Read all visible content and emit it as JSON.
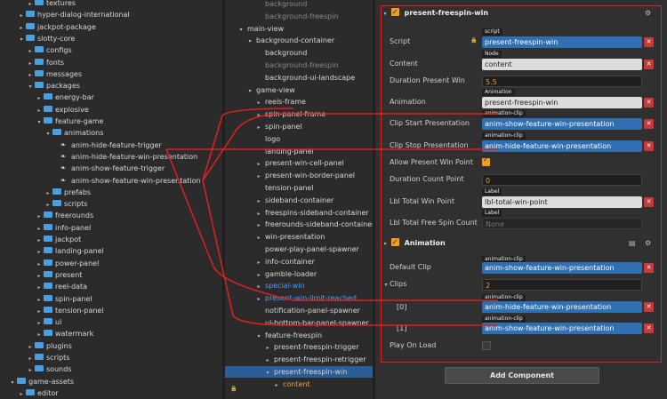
{
  "assets": {
    "items": [
      {
        "label": "textures",
        "depth": 3,
        "arrow": "▸",
        "kind": "folder"
      },
      {
        "label": "hyper-dialog-international",
        "depth": 2,
        "arrow": "▸",
        "kind": "folder"
      },
      {
        "label": "jackpot-package",
        "depth": 2,
        "arrow": "▸",
        "kind": "folder"
      },
      {
        "label": "slotty-core",
        "depth": 2,
        "arrow": "▾",
        "kind": "folder"
      },
      {
        "label": "configs",
        "depth": 3,
        "arrow": "▸",
        "kind": "folder"
      },
      {
        "label": "fonts",
        "depth": 3,
        "arrow": "▸",
        "kind": "folder"
      },
      {
        "label": "messages",
        "depth": 3,
        "arrow": "▸",
        "kind": "folder"
      },
      {
        "label": "packages",
        "depth": 3,
        "arrow": "▾",
        "kind": "folder"
      },
      {
        "label": "energy-bar",
        "depth": 4,
        "arrow": "▸",
        "kind": "folder"
      },
      {
        "label": "explosive",
        "depth": 4,
        "arrow": "▸",
        "kind": "folder"
      },
      {
        "label": "feature-game",
        "depth": 4,
        "arrow": "▾",
        "kind": "folder"
      },
      {
        "label": "animations",
        "depth": 5,
        "arrow": "▾",
        "kind": "folder"
      },
      {
        "label": "anim-hide-feature-trigger",
        "depth": 6,
        "arrow": "",
        "kind": "anim"
      },
      {
        "label": "anim-hide-feature-win-presentation",
        "depth": 6,
        "arrow": "",
        "kind": "anim"
      },
      {
        "label": "anim-show-feature-trigger",
        "depth": 6,
        "arrow": "",
        "kind": "anim"
      },
      {
        "label": "anim-show-feature-win-presentation",
        "depth": 6,
        "arrow": "",
        "kind": "anim"
      },
      {
        "label": "prefabs",
        "depth": 5,
        "arrow": "▸",
        "kind": "folder"
      },
      {
        "label": "scripts",
        "depth": 5,
        "arrow": "▸",
        "kind": "folder"
      },
      {
        "label": "freerounds",
        "depth": 4,
        "arrow": "▸",
        "kind": "folder"
      },
      {
        "label": "info-panel",
        "depth": 4,
        "arrow": "▸",
        "kind": "folder"
      },
      {
        "label": "jackpot",
        "depth": 4,
        "arrow": "▸",
        "kind": "folder"
      },
      {
        "label": "landing-panel",
        "depth": 4,
        "arrow": "▸",
        "kind": "folder"
      },
      {
        "label": "power-panel",
        "depth": 4,
        "arrow": "▸",
        "kind": "folder"
      },
      {
        "label": "present",
        "depth": 4,
        "arrow": "▸",
        "kind": "folder"
      },
      {
        "label": "reel-data",
        "depth": 4,
        "arrow": "▸",
        "kind": "folder"
      },
      {
        "label": "spin-panel",
        "depth": 4,
        "arrow": "▸",
        "kind": "folder"
      },
      {
        "label": "tension-panel",
        "depth": 4,
        "arrow": "▸",
        "kind": "folder"
      },
      {
        "label": "ui",
        "depth": 4,
        "arrow": "▸",
        "kind": "folder"
      },
      {
        "label": "watermark",
        "depth": 4,
        "arrow": "▸",
        "kind": "folder"
      },
      {
        "label": "plugins",
        "depth": 3,
        "arrow": "▸",
        "kind": "folder"
      },
      {
        "label": "scripts",
        "depth": 3,
        "arrow": "▸",
        "kind": "folder"
      },
      {
        "label": "sounds",
        "depth": 3,
        "arrow": "▸",
        "kind": "folder"
      },
      {
        "label": "game-assets",
        "depth": 1,
        "arrow": "▾",
        "kind": "folder"
      },
      {
        "label": "editor",
        "depth": 2,
        "arrow": "▸",
        "kind": "folder"
      }
    ]
  },
  "hierarchy": {
    "items": [
      {
        "label": "background",
        "depth": 3,
        "arrow": "",
        "style": "gray"
      },
      {
        "label": "background-freespin",
        "depth": 3,
        "arrow": "",
        "style": "gray"
      },
      {
        "label": "main-view",
        "depth": 1,
        "arrow": "▾",
        "style": ""
      },
      {
        "label": "background-container",
        "depth": 2,
        "arrow": "▾",
        "style": ""
      },
      {
        "label": "background",
        "depth": 3,
        "arrow": "",
        "style": ""
      },
      {
        "label": "background-freespin",
        "depth": 3,
        "arrow": "",
        "style": "gray"
      },
      {
        "label": "background-ui-landscape",
        "depth": 3,
        "arrow": "",
        "style": ""
      },
      {
        "label": "game-view",
        "depth": 2,
        "arrow": "▾",
        "style": ""
      },
      {
        "label": "reels-frame",
        "depth": 3,
        "arrow": "▸",
        "style": ""
      },
      {
        "label": "spin-panel-frame",
        "depth": 3,
        "arrow": "▸",
        "style": ""
      },
      {
        "label": "spin-panel",
        "depth": 3,
        "arrow": "▸",
        "style": ""
      },
      {
        "label": "logo",
        "depth": 3,
        "arrow": "",
        "style": ""
      },
      {
        "label": "landing-panel",
        "depth": 3,
        "arrow": "",
        "style": ""
      },
      {
        "label": "present-win-cell-panel",
        "depth": 3,
        "arrow": "▸",
        "style": ""
      },
      {
        "label": "present-win-border-panel",
        "depth": 3,
        "arrow": "▸",
        "style": ""
      },
      {
        "label": "tension-panel",
        "depth": 3,
        "arrow": "",
        "style": ""
      },
      {
        "label": "sideband-container",
        "depth": 3,
        "arrow": "▸",
        "style": ""
      },
      {
        "label": "freespins-sideband-container",
        "depth": 3,
        "arrow": "▸",
        "style": ""
      },
      {
        "label": "freerounds-sideband-container",
        "depth": 3,
        "arrow": "▸",
        "style": ""
      },
      {
        "label": "win-presentation",
        "depth": 3,
        "arrow": "▸",
        "style": ""
      },
      {
        "label": "power-play-panel-spawner",
        "depth": 3,
        "arrow": "",
        "style": ""
      },
      {
        "label": "info-container",
        "depth": 3,
        "arrow": "▸",
        "style": ""
      },
      {
        "label": "gamble-loader",
        "depth": 3,
        "arrow": "▸",
        "style": ""
      },
      {
        "label": "special-win",
        "depth": 3,
        "arrow": "▸",
        "style": "blue"
      },
      {
        "label": "present-win-limit-reached",
        "depth": 3,
        "arrow": "▸",
        "style": "blue"
      },
      {
        "label": "notification-panel-spawner",
        "depth": 3,
        "arrow": "",
        "style": ""
      },
      {
        "label": "ui-bottom-bar-panel-spawner",
        "depth": 3,
        "arrow": "",
        "style": ""
      },
      {
        "label": "feature-freespin",
        "depth": 3,
        "arrow": "▾",
        "style": ""
      },
      {
        "label": "present-freespin-trigger",
        "depth": 4,
        "arrow": "▸",
        "style": ""
      },
      {
        "label": "present-freespin-retrigger",
        "depth": 4,
        "arrow": "▸",
        "style": ""
      },
      {
        "label": "present-freespin-win",
        "depth": 4,
        "arrow": "▾",
        "style": "selected"
      },
      {
        "label": "content",
        "depth": 5,
        "arrow": "▸",
        "style": "orange"
      }
    ]
  },
  "inspector": {
    "component1": {
      "title": "present-freespin-win",
      "props": [
        {
          "label": "Script",
          "tag": "script",
          "value": "present-freespin-win",
          "kind": "blue-f",
          "x": true,
          "lock": true
        },
        {
          "label": "Content",
          "tag": "Node",
          "value": "content",
          "kind": "gray-f",
          "x": true
        },
        {
          "label": "Duration Present Win",
          "tag": "",
          "value": "5.5",
          "kind": "dark-f",
          "x": false
        },
        {
          "label": "Animation",
          "tag": "Animation",
          "value": "present-freespin-win",
          "kind": "gray-f",
          "x": true
        },
        {
          "label": "Clip Start Presentation",
          "tag": "animation-clip",
          "value": "anim-show-feature-win-presentation",
          "kind": "blue-f",
          "x": true
        },
        {
          "label": "Clip Stop Presentation",
          "tag": "animation-clip",
          "value": "anim-hide-feature-win-presentation",
          "kind": "blue-f",
          "x": true
        },
        {
          "label": "Allow Present Win Point",
          "tag": "",
          "value": "",
          "kind": "check",
          "x": false
        },
        {
          "label": "Duration Count Point",
          "tag": "",
          "value": "0",
          "kind": "dark-f",
          "x": false
        },
        {
          "label": "Lbl Total Win Point",
          "tag": "Label",
          "value": "lbl-total-win-point",
          "kind": "gray-f",
          "x": true
        },
        {
          "label": "Lbl Total Free Spin Count",
          "tag": "Label",
          "value": "None",
          "kind": "none-f",
          "x": false
        }
      ]
    },
    "component2": {
      "title": "Animation",
      "default_clip_label": "Default Clip",
      "default_clip_tag": "animation-clip",
      "default_clip_value": "anim-show-feature-win-presentation",
      "clips_label": "Clips",
      "clips_count": "2",
      "clip0_label": "[0]",
      "clip0_tag": "animation-clip",
      "clip0_value": "anim-hide-feature-win-presentation",
      "clip1_label": "[1]",
      "clip1_tag": "animation-clip",
      "clip1_value": "anim-show-feature-win-presentation",
      "play_on_load_label": "Play On Load"
    },
    "add_component_label": "Add Component"
  },
  "colors": {
    "accent": "#2f6fb2",
    "highlight_box": "#e02020",
    "checkbox": "#f0a020",
    "remove_button": "#c43a3a"
  }
}
